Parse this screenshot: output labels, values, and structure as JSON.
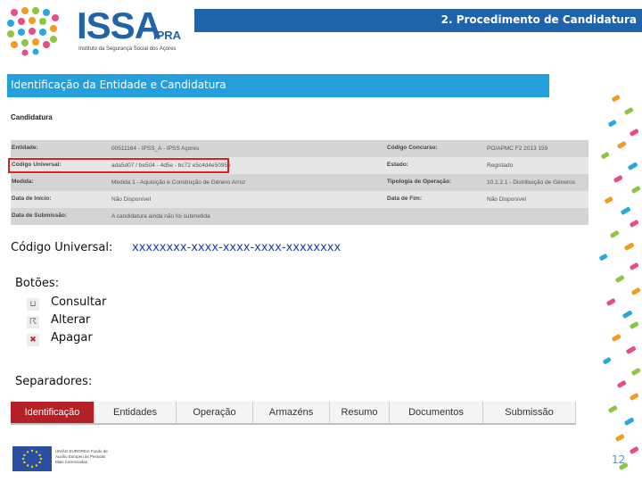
{
  "header": {
    "logo": {
      "name": "ISSA",
      "sub": "IPRA",
      "tagline": "Instituto da Segurança Social dos Açores"
    },
    "title": "2. Procedimento de Candidatura"
  },
  "section": {
    "title": "Identificação da Entidade e Candidatura"
  },
  "candidatura": {
    "heading": "Candidatura",
    "rows": [
      {
        "label": "Entidade:",
        "value": "00511164 - IPSS_A - IPSS Açores",
        "label2": "Código Concurso:",
        "value2": "PO/APMC F2 2013 159"
      },
      {
        "label": "Código Universal:",
        "value": "ada5d07 / be504 - 4d5e - bc72 e5c4d4e5095e",
        "label2": "Estado:",
        "value2": "Registado"
      },
      {
        "label": "Medida:",
        "value": "Medida 1 - Aquisição e Construção de Género Arroz",
        "label2": "Tipologia de Operação:",
        "value2": "10.1.2.1 - Distribuição de Géneros"
      },
      {
        "label": "Data de Início:",
        "value": "Não Disponível",
        "label2": "Data de Fim:",
        "value2": "Não Disponível"
      },
      {
        "label": "Data de Submissão:",
        "value": "A candidatura ainda não foi submetida",
        "label2": "",
        "value2": ""
      }
    ]
  },
  "code": {
    "label": "Código Universal:",
    "value": "xxxxxxxx-xxxx-xxxx-xxxx-xxxxxxxx"
  },
  "buttons": {
    "heading": "Botões:",
    "items": [
      {
        "label": "Consultar",
        "icon": "consult-icon",
        "glyph": "⊔",
        "color": "#555555"
      },
      {
        "label": "Alterar",
        "icon": "edit-icon",
        "glyph": "☈",
        "color": "#555555"
      },
      {
        "label": "Apagar",
        "icon": "delete-icon",
        "glyph": "✖",
        "color": "#c0262d"
      }
    ]
  },
  "separators": {
    "heading": "Separadores:",
    "tabs": [
      {
        "label": "Identificação",
        "active": true
      },
      {
        "label": "Entidades",
        "active": false
      },
      {
        "label": "Operação",
        "active": false
      },
      {
        "label": "Armazéns",
        "active": false
      },
      {
        "label": "Resumo",
        "active": false
      },
      {
        "label": "Documentos",
        "active": false
      },
      {
        "label": "Submissão",
        "active": false
      }
    ]
  },
  "footer": {
    "eu_text": "UNIÃO EUROPEIA Fundo de Auxílio Europeu às Pessoas Mais Carenciadas",
    "page_number": "12"
  },
  "colors": {
    "header_blue": "#1f64a8",
    "section_blue": "#23a0dc",
    "highlight_red": "#e02020",
    "tab_active": "#b32026",
    "code_blue": "#1f3ea8"
  }
}
